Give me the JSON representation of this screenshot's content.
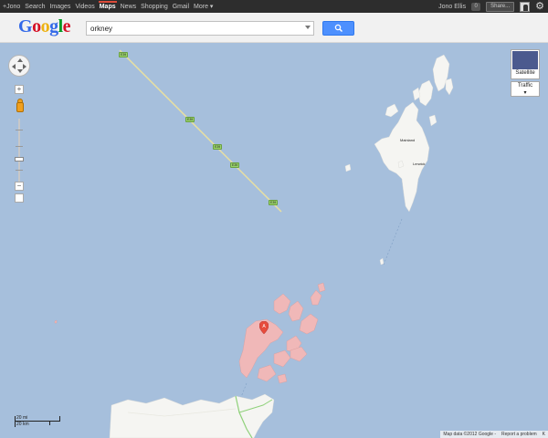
{
  "topbar": {
    "nav": [
      "+Jono",
      "Search",
      "Images",
      "Videos",
      "Maps",
      "News",
      "Shopping",
      "Gmail",
      "More ▾"
    ],
    "active_nav": "Maps",
    "user_name": "Jono Ellis",
    "notifications": "0",
    "share_label": "Share..."
  },
  "header": {
    "logo_letters": [
      {
        "ch": "G",
        "color": "#3369e8"
      },
      {
        "ch": "o",
        "color": "#d50f25"
      },
      {
        "ch": "o",
        "color": "#eeb211"
      },
      {
        "ch": "g",
        "color": "#3369e8"
      },
      {
        "ch": "l",
        "color": "#009925"
      },
      {
        "ch": "e",
        "color": "#d50f25"
      }
    ],
    "search_value": "orkney",
    "search_icon": "search-icon"
  },
  "map": {
    "colors": {
      "water": "#a6bfdc",
      "land": "#f5f5f2",
      "highlight": "#f0b8b8",
      "ferry": "#e9e0a0"
    },
    "labels": {
      "mainland": "Mainland",
      "lerwick": "Lerwick"
    },
    "road_shields": [
      "E39",
      "E39",
      "E39",
      "E39",
      "E39"
    ],
    "marker_label": "A"
  },
  "controls": {
    "zoom_in": "+",
    "zoom_out": "−",
    "satellite_label": "Satellite",
    "traffic_label": "Traffic"
  },
  "scale": {
    "miles": "20 mi",
    "km": "20 km"
  },
  "footer": {
    "attribution": "Map data ©2012 Google -",
    "report": "Report a problem",
    "extra": "K"
  }
}
